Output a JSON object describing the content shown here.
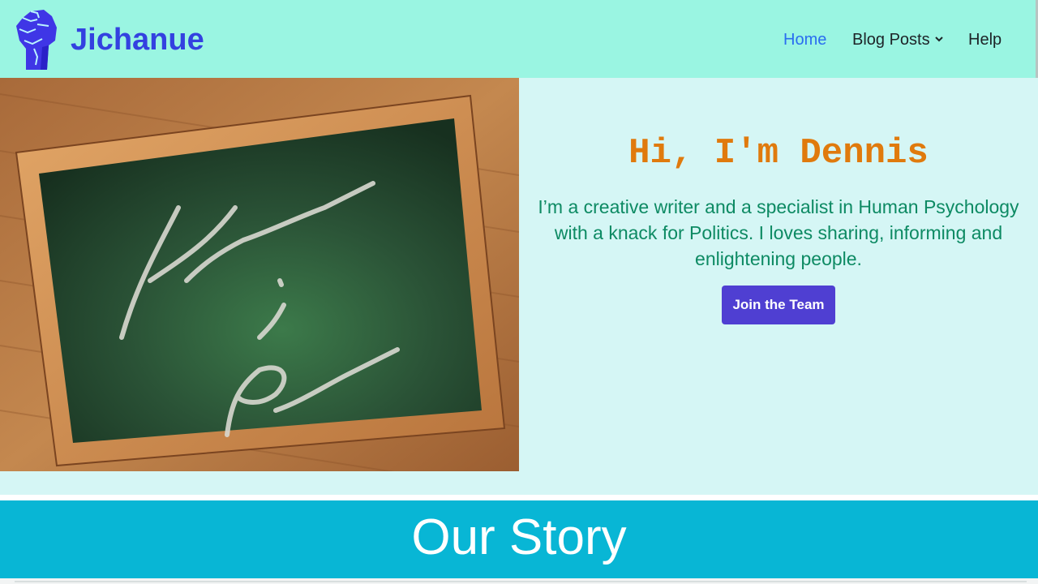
{
  "brand": {
    "name": "Jichanue",
    "logo_icon": "raised-fist-icon",
    "color": "#3341e0"
  },
  "nav": {
    "items": [
      {
        "label": "Home",
        "active": true
      },
      {
        "label": "Blog Posts",
        "has_dropdown": true,
        "icon": "chevron-down-icon"
      },
      {
        "label": "Help"
      }
    ]
  },
  "hero": {
    "image_text": [
      "Knowledge",
      "is",
      "Power"
    ],
    "title": "Hi, I'm Dennis",
    "description": "I’m a creative writer and a specialist in Human Psychology with a knack for Politics. I loves sharing, informing and enlightening people.",
    "cta_label": "Join the Team"
  },
  "story": {
    "title": "Our Story"
  },
  "colors": {
    "header_bg": "#9af5e2",
    "hero_bg": "#d5f6f5",
    "title": "#e07a0d",
    "text": "#0d8a63",
    "button": "#4f3fd2",
    "story_bg": "#08b6d5",
    "nav_active": "#2a6df0"
  }
}
